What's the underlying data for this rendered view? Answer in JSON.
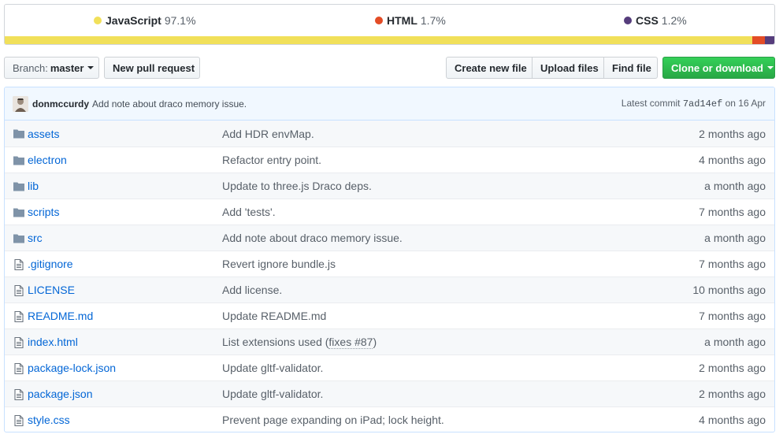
{
  "languages": [
    {
      "name": "JavaScript",
      "percent": "97.1%",
      "color": "#f1e05a",
      "share": 97.1
    },
    {
      "name": "HTML",
      "percent": "1.7%",
      "color": "#e34c26",
      "share": 1.7
    },
    {
      "name": "CSS",
      "percent": "1.2%",
      "color": "#563d7c",
      "share": 1.2
    }
  ],
  "toolbar": {
    "branch_prefix": "Branch:",
    "branch_name": "master",
    "new_pull_request": "New pull request",
    "create_new_file": "Create new file",
    "upload_files": "Upload files",
    "find_file": "Find file",
    "clone_or_download": "Clone or download"
  },
  "latest_commit": {
    "author": "donmccurdy",
    "message": "Add note about draco memory issue.",
    "prefix": "Latest commit",
    "sha": "7ad14ef",
    "date_prefix": "on",
    "date": "16 Apr"
  },
  "files": [
    {
      "type": "folder",
      "name": "assets",
      "message": "Add HDR envMap.",
      "age": "2 months ago"
    },
    {
      "type": "folder",
      "name": "electron",
      "message": "Refactor entry point.",
      "age": "4 months ago"
    },
    {
      "type": "folder",
      "name": "lib",
      "message": "Update to three.js Draco deps.",
      "age": "a month ago"
    },
    {
      "type": "folder",
      "name": "scripts",
      "message": "Add 'tests'.",
      "age": "7 months ago"
    },
    {
      "type": "folder",
      "name": "src",
      "message": "Add note about draco memory issue.",
      "age": "a month ago"
    },
    {
      "type": "file",
      "name": ".gitignore",
      "message": "Revert ignore bundle.js",
      "age": "7 months ago"
    },
    {
      "type": "file",
      "name": "LICENSE",
      "message": "Add license.",
      "age": "10 months ago"
    },
    {
      "type": "file",
      "name": "README.md",
      "message": "Update README.md",
      "age": "7 months ago"
    },
    {
      "type": "file",
      "name": "index.html",
      "message": "List extensions used (",
      "message_link": "fixes #87",
      "message_suffix": ")",
      "age": "a month ago"
    },
    {
      "type": "file",
      "name": "package-lock.json",
      "message": "Update gltf-validator.",
      "age": "2 months ago"
    },
    {
      "type": "file",
      "name": "package.json",
      "message": "Update gltf-validator.",
      "age": "2 months ago"
    },
    {
      "type": "file",
      "name": "style.css",
      "message": "Prevent page expanding on iPad; lock height.",
      "age": "4 months ago"
    }
  ]
}
